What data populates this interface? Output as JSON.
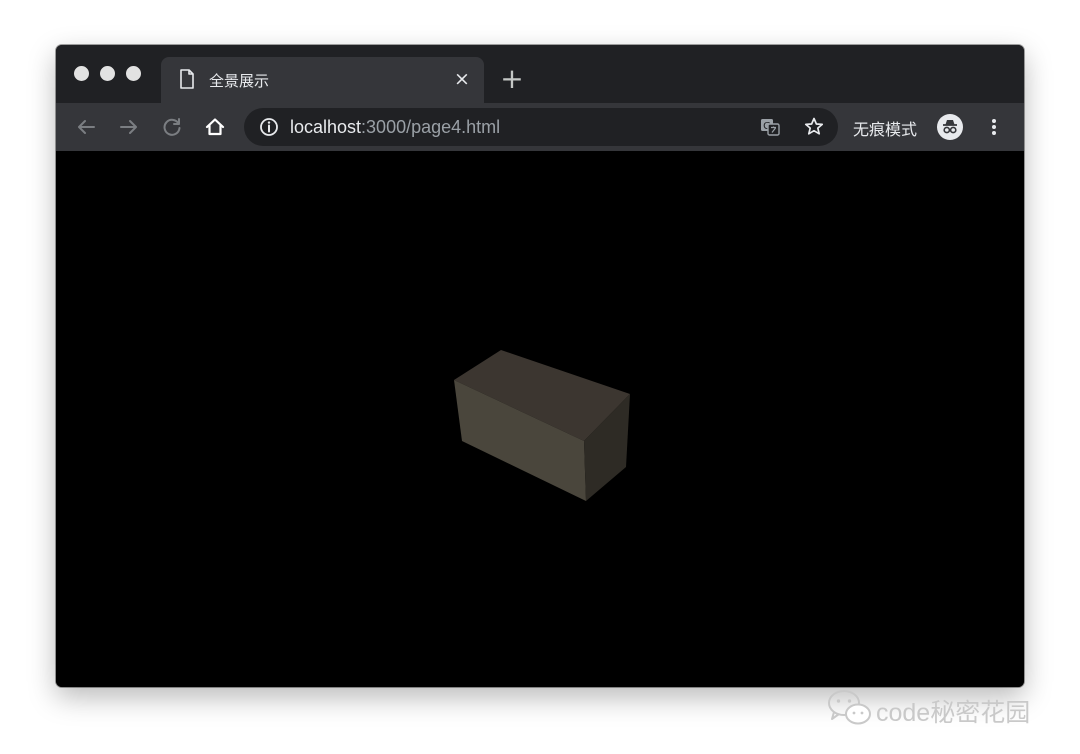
{
  "window": {
    "tab": {
      "title": "全景展示",
      "close_symbol": "×",
      "page_icon": "document-icon"
    },
    "new_tab_symbol": "+",
    "traffic_lights": [
      "close-dot",
      "minimize-dot",
      "zoom-dot"
    ]
  },
  "toolbar": {
    "back_icon": "arrow-left-icon",
    "forward_icon": "arrow-right-icon",
    "reload_icon": "reload-icon",
    "home_icon": "home-icon",
    "address": {
      "info_icon": "info-icon",
      "host": "localhost",
      "rest": ":3000/page4.html"
    },
    "translate_icon": "translate-icon",
    "bookmark_icon": "star-icon",
    "incognito_label": "无痕模式",
    "incognito_icon": "incognito-icon",
    "menu_icon": "more-vert-icon"
  },
  "scene": {
    "background": "#000000",
    "object": "box",
    "face_colors": {
      "top": "#3c3630",
      "front": "#4a463c",
      "side": "#2e2b25"
    }
  },
  "watermark": {
    "icon": "wechat-icon",
    "text": "code秘密花园"
  }
}
